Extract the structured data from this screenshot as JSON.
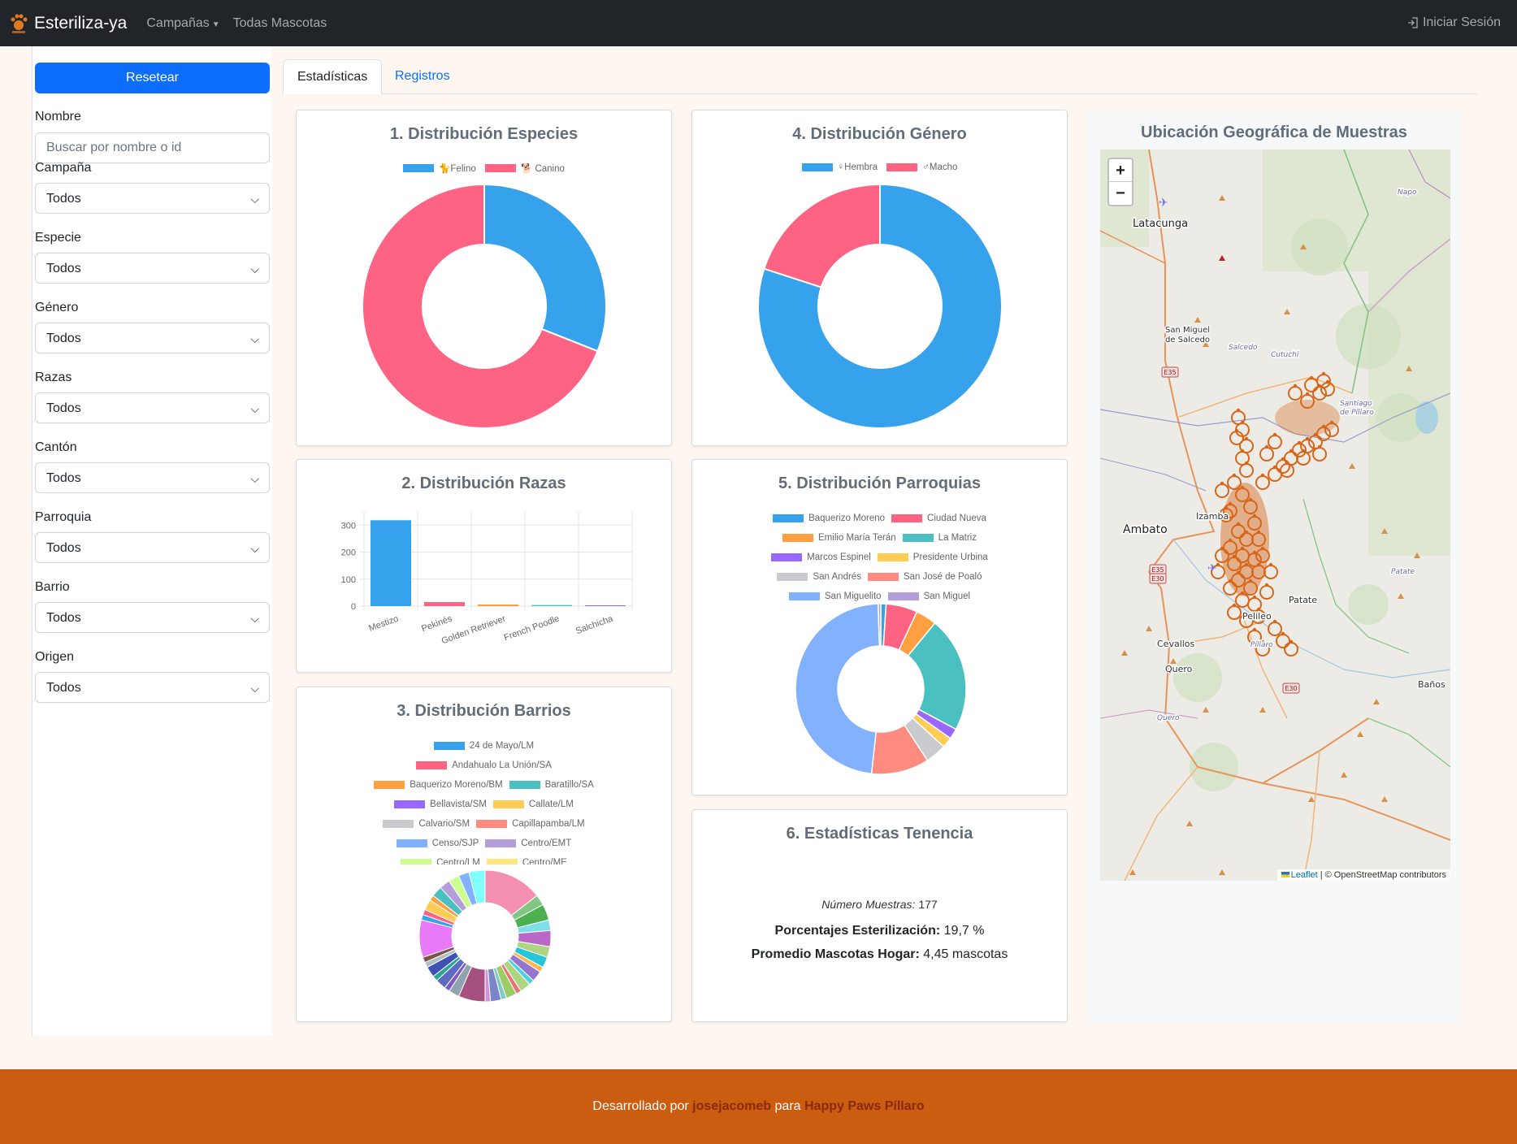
{
  "navbar": {
    "brand": "Esteriliza-ya",
    "campaigns": "Campañas",
    "all_pets": "Todas Mascotas",
    "login": "Iniciar Sesión"
  },
  "sidebar": {
    "reset": "Resetear",
    "name_label": "Nombre",
    "name_placeholder": "Buscar por nombre o id",
    "filters": [
      {
        "label": "Campaña",
        "value": "Todos"
      },
      {
        "label": "Especie",
        "value": "Todos"
      },
      {
        "label": "Género",
        "value": "Todos"
      },
      {
        "label": "Razas",
        "value": "Todos"
      },
      {
        "label": "Cantón",
        "value": "Todos"
      },
      {
        "label": "Parroquia",
        "value": "Todos"
      },
      {
        "label": "Barrio",
        "value": "Todos"
      },
      {
        "label": "Origen",
        "value": "Todos"
      }
    ]
  },
  "tabs": {
    "stats": "Estadísticas",
    "records": "Registros"
  },
  "cards": {
    "species": "1. Distribución Especies",
    "breeds": "2. Distribución Razas",
    "barrios": "3. Distribución Barrios",
    "gender": "4. Distribución Género",
    "parishes": "5. Distribución Parroquias",
    "ownership": "6. Estadísticas Tenencia",
    "map": "Ubicación Geográfica de Muestras"
  },
  "ownership": {
    "samples_label": "Número Muestras:",
    "samples_value": "177",
    "sterilization_label": "Porcentajes Esterilización:",
    "sterilization_value": "19,7 %",
    "avg_label": "Promedio Mascotas Hogar:",
    "avg_value": "4,45 mascotas"
  },
  "map": {
    "zoom_in": "+",
    "zoom_out": "−",
    "attrib_leaflet": "Leaflet",
    "attrib_osm": "| © OpenStreetMap contributors",
    "places": [
      {
        "name": "Latacunga"
      },
      {
        "name": "San Miguel"
      },
      {
        "name": "de Salcedo"
      },
      {
        "name": "Salcedo"
      },
      {
        "name": "Cutuchi"
      },
      {
        "name": "Santiago"
      },
      {
        "name": "de Píllaro"
      },
      {
        "name": "Izamba"
      },
      {
        "name": "Ambato"
      },
      {
        "name": "Patate"
      },
      {
        "name": "Pelileo"
      },
      {
        "name": "Píllaro"
      },
      {
        "name": "Cevallos"
      },
      {
        "name": "Quero"
      },
      {
        "name": "Baños"
      },
      {
        "name": "Napo"
      },
      {
        "name": "Patate"
      },
      {
        "name": "Quero"
      }
    ],
    "roads": [
      "E35",
      "E35",
      "E30",
      "E30"
    ]
  },
  "footer": {
    "prefix": "Desarrollado por",
    "author": "josejacomeb",
    "middle": "para",
    "org": "Happy Paws Píllaro"
  },
  "chart_data": [
    {
      "type": "pie",
      "title": "1. Distribución Especies",
      "labels": [
        "🐈Felino",
        "🐕 Canino"
      ],
      "values": [
        31,
        69
      ],
      "colors": [
        "#36a2eb",
        "#ff6384"
      ]
    },
    {
      "type": "bar",
      "title": "2. Distribución Razas",
      "categories": [
        "Mestizo",
        "Pekinés",
        "Golden Retriever",
        "French Poodle",
        "Salchicha"
      ],
      "values": [
        318,
        15,
        6,
        4,
        3
      ],
      "colors": [
        "#36a2eb",
        "#ff6384",
        "#ff9f40",
        "#4bc0c0",
        "#9966ff"
      ],
      "ylim": [
        0,
        340
      ],
      "yticks": [
        0,
        100,
        200,
        300
      ]
    },
    {
      "type": "pie",
      "title": "3. Distribución Barrios",
      "labels": [
        "24 de Mayo/LM",
        "Andahualo La Unión/SA",
        "Baquerizo Moreno/BM",
        "Baratillo/SA",
        "Bellavista/SM",
        "Callate/LM",
        "Calvario/SM",
        "Capillapamba/LM",
        "Censo/SJP",
        "Centro/EMT",
        "Centro/LM",
        "Centro/ME"
      ],
      "colors": [
        "#36a2eb",
        "#ff6384",
        "#ff9f40",
        "#4bc0c0",
        "#9966ff",
        "#ffcd56",
        "#c9cbcf",
        "#ff8a80",
        "#82b1ff",
        "#b39ddb",
        "#ccff90",
        "#ffe57f"
      ],
      "slices": [
        {
          "v": 11,
          "c": "#f48fb1"
        },
        {
          "v": 2,
          "c": "#81c784"
        },
        {
          "v": 3,
          "c": "#4caf50"
        },
        {
          "v": 2,
          "c": "#80deea"
        },
        {
          "v": 3,
          "c": "#ba68c8"
        },
        {
          "v": 2,
          "c": "#aed581"
        },
        {
          "v": 2,
          "c": "#26c6da"
        },
        {
          "v": 1,
          "c": "#ffb74d"
        },
        {
          "v": 2,
          "c": "#9575cd"
        },
        {
          "v": 1,
          "c": "#4dd0e1"
        },
        {
          "v": 2,
          "c": "#aed581"
        },
        {
          "v": 1,
          "c": "#e57373"
        },
        {
          "v": 2,
          "c": "#9ccc65"
        },
        {
          "v": 1,
          "c": "#80cbc4"
        },
        {
          "v": 2,
          "c": "#7986cb"
        },
        {
          "v": 1,
          "c": "#ce93d8"
        },
        {
          "v": 5,
          "c": "#a5507e"
        },
        {
          "v": 2,
          "c": "#90a4ae"
        },
        {
          "v": 1,
          "c": "#7e57c2"
        },
        {
          "v": 2,
          "c": "#5c6bc0"
        },
        {
          "v": 1,
          "c": "#26a69a"
        },
        {
          "v": 2,
          "c": "#3f51b5"
        },
        {
          "v": 1,
          "c": "#b0bec5"
        },
        {
          "v": 1,
          "c": "#795548"
        },
        {
          "v": 7,
          "c": "#e879f9"
        },
        {
          "v": 1,
          "c": "#36a2eb"
        },
        {
          "v": 1,
          "c": "#ff6384"
        },
        {
          "v": 2,
          "c": "#ffcd56"
        },
        {
          "v": 1,
          "c": "#ff9f40"
        },
        {
          "v": 2,
          "c": "#4bc0c0"
        },
        {
          "v": 2,
          "c": "#b39ddb"
        },
        {
          "v": 2,
          "c": "#ccff90"
        },
        {
          "v": 2,
          "c": "#82b1ff"
        },
        {
          "v": 3,
          "c": "#80ffff"
        }
      ]
    },
    {
      "type": "pie",
      "title": "4. Distribución Género",
      "labels": [
        "♀Hembra",
        "♂Macho"
      ],
      "values": [
        80,
        20
      ],
      "colors": [
        "#36a2eb",
        "#ff6384"
      ]
    },
    {
      "type": "pie",
      "title": "5. Distribución Parroquias",
      "labels": [
        "Baquerizo Moreno",
        "Ciudad Nueva",
        "Emilio María Terán",
        "La Matriz",
        "Marcos Espinel",
        "Presidente Urbina",
        "San Andrés",
        "San José de Poaló",
        "San Miguelito",
        "San Miguel"
      ],
      "values": [
        1,
        6,
        4,
        22,
        2,
        2,
        4,
        11,
        48,
        0.5
      ],
      "colors": [
        "#36a2eb",
        "#ff6384",
        "#ff9f40",
        "#4bc0c0",
        "#9966ff",
        "#ffcd56",
        "#c9cbcf",
        "#ff8a80",
        "#82b1ff",
        "#b39ddb"
      ]
    }
  ]
}
